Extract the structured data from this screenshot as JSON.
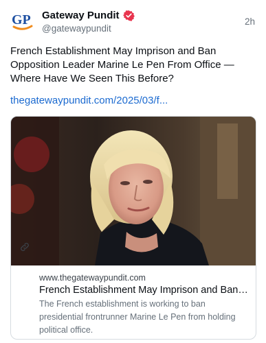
{
  "author": {
    "avatar_text": "GP",
    "display_name": "Gateway Pundit",
    "handle": "@gatewaypundit",
    "verified_icon": "verified-badge-icon"
  },
  "post": {
    "timestamp": "2h",
    "text": "French Establishment May Imprison and Ban Opposition Leader Marine Le Pen From Office — Where Have We Seen This Before?",
    "link_text": "thegatewaypundit.com/2025/03/f..."
  },
  "link_card": {
    "image": "portrait-photo",
    "icon": "link-icon",
    "domain": "www.thegatewaypundit.com",
    "title": "French Establishment May Imprison and Ban O...",
    "description": "The French establishment is working to ban presidential frontrunner Marine Le Pen from holding political office."
  },
  "colors": {
    "link": "#1b6ad0",
    "verified": "#e8344e",
    "avatar_blue": "#1d4fa1",
    "avatar_orange": "#f08c1e"
  }
}
